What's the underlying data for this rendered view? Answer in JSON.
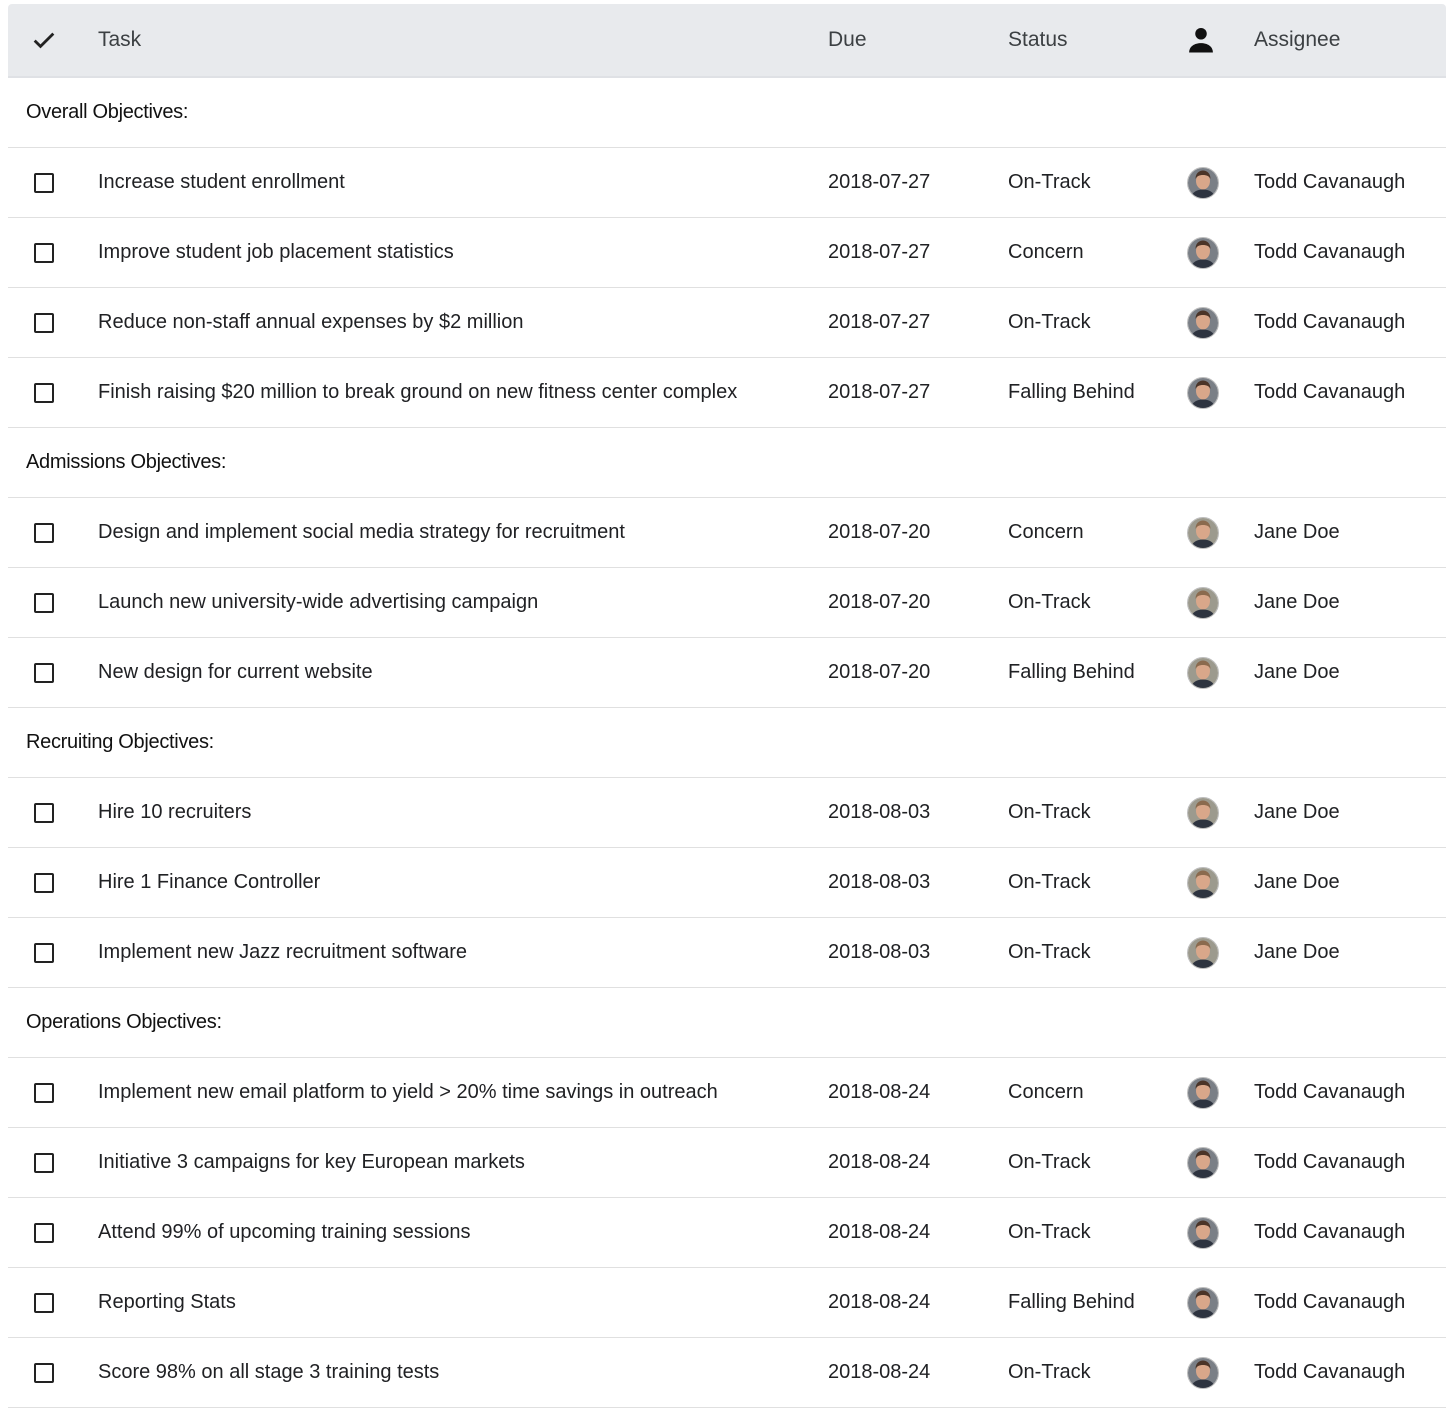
{
  "header": {
    "check_icon": "checkmark-icon",
    "task": "Task",
    "due": "Due",
    "status": "Status",
    "person_icon": "person-icon",
    "assignee": "Assignee"
  },
  "groups": [
    {
      "label": "Overall Objectives:",
      "rows": [
        {
          "task": "Increase student enrollment",
          "due": "2018-07-27",
          "status": "On-Track",
          "assignee": "Todd Cavanaugh",
          "checked": false
        },
        {
          "task": "Improve student job placement statistics",
          "due": "2018-07-27",
          "status": "Concern",
          "assignee": "Todd Cavanaugh",
          "checked": false
        },
        {
          "task": "Reduce non-staff annual expenses by $2 million",
          "due": "2018-07-27",
          "status": "On-Track",
          "assignee": "Todd Cavanaugh",
          "checked": false
        },
        {
          "task": "Finish raising $20 million to break ground on new fitness center complex",
          "due": "2018-07-27",
          "status": "Falling Behind",
          "assignee": "Todd Cavanaugh",
          "checked": false
        }
      ]
    },
    {
      "label": "Admissions Objectives:",
      "rows": [
        {
          "task": "Design and implement social media strategy for recruitment",
          "due": "2018-07-20",
          "status": "Concern",
          "assignee": "Jane Doe",
          "checked": false
        },
        {
          "task": "Launch new university-wide advertising campaign",
          "due": "2018-07-20",
          "status": "On-Track",
          "assignee": "Jane Doe",
          "checked": false
        },
        {
          "task": "New design for current website",
          "due": "2018-07-20",
          "status": "Falling Behind",
          "assignee": "Jane Doe",
          "checked": false
        }
      ]
    },
    {
      "label": "Recruiting Objectives:",
      "rows": [
        {
          "task": "Hire 10 recruiters",
          "due": "2018-08-03",
          "status": "On-Track",
          "assignee": "Jane Doe",
          "checked": false
        },
        {
          "task": "Hire 1 Finance Controller",
          "due": "2018-08-03",
          "status": "On-Track",
          "assignee": "Jane Doe",
          "checked": false
        },
        {
          "task": "Implement new Jazz recruitment software",
          "due": "2018-08-03",
          "status": "On-Track",
          "assignee": "Jane Doe",
          "checked": false
        }
      ]
    },
    {
      "label": "Operations Objectives:",
      "rows": [
        {
          "task": "Implement new email platform to yield > 20% time savings in outreach",
          "due": "2018-08-24",
          "status": "Concern",
          "assignee": "Todd Cavanaugh",
          "checked": false
        },
        {
          "task": "Initiative 3 campaigns for key European markets",
          "due": "2018-08-24",
          "status": "On-Track",
          "assignee": "Todd Cavanaugh",
          "checked": false
        },
        {
          "task": "Attend 99% of upcoming training sessions",
          "due": "2018-08-24",
          "status": "On-Track",
          "assignee": "Todd Cavanaugh",
          "checked": false
        },
        {
          "task": "Reporting Stats",
          "due": "2018-08-24",
          "status": "Falling Behind",
          "assignee": "Todd Cavanaugh",
          "checked": false
        },
        {
          "task": "Score 98% on all stage 3 training tests",
          "due": "2018-08-24",
          "status": "On-Track",
          "assignee": "Todd Cavanaugh",
          "checked": false
        }
      ]
    }
  ]
}
